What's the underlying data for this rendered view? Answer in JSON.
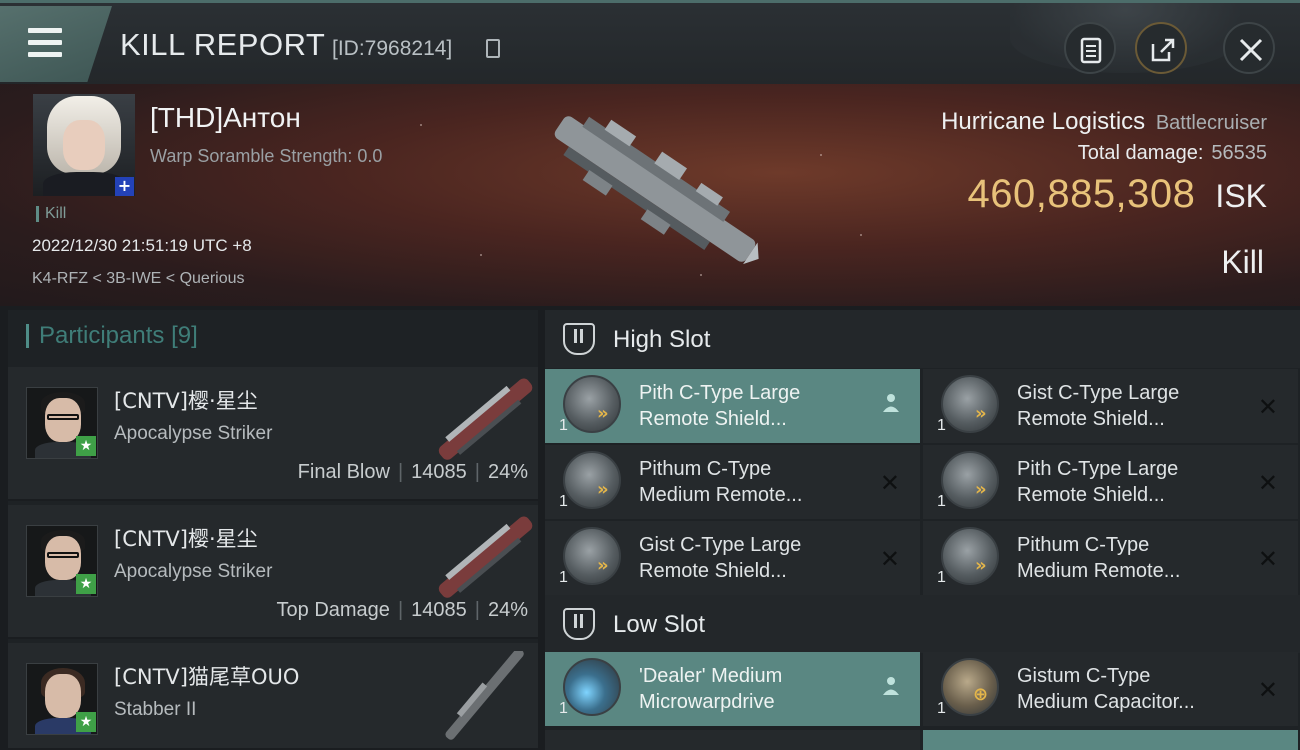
{
  "header": {
    "title": "KILL REPORT",
    "report_id": "[ID:7968214]",
    "menu_icon": "hamburger-icon",
    "actions": [
      "clipboard-icon",
      "share-icon",
      "close-icon"
    ]
  },
  "victim": {
    "name": "[THD]Антон",
    "warp_scramble": "Warp Soramble Strength: 0.0",
    "tag": "Kill",
    "datetime": "2022/12/30 21:51:19 UTC +8",
    "location": "K4-RFZ < 3B-IWE < Querious",
    "ship_name": "Hurricane Logistics",
    "ship_class": "Battlecruiser",
    "total_damage_label": "Total damage:",
    "total_damage": "56535",
    "isk_value": "460,885,308",
    "isk_unit": "ISK",
    "result": "Kill"
  },
  "participants": {
    "label": "Participants",
    "count": "[9]",
    "items": [
      {
        "name": "[CNTV]樱·星尘",
        "ship": "Apocalypse Striker",
        "role": "Final Blow",
        "damage": "14085",
        "percent": "24%"
      },
      {
        "name": "[CNTV]樱·星尘",
        "ship": "Apocalypse Striker",
        "role": "Top Damage",
        "damage": "14085",
        "percent": "24%"
      },
      {
        "name": "[CNTV]猫尾草OUO",
        "ship": "Stabber II",
        "role": "",
        "damage": "",
        "percent": ""
      }
    ]
  },
  "slots": {
    "high": {
      "label": "High Slot",
      "items": [
        {
          "qty": "1",
          "line1": "Pith C-Type Large",
          "line2": "Remote Shield...",
          "status": "person-icon",
          "selected": true
        },
        {
          "qty": "1",
          "line1": "Gist C-Type Large",
          "line2": "Remote Shield...",
          "status": "x-icon"
        },
        {
          "qty": "1",
          "line1": "Pithum C-Type",
          "line2": "Medium Remote...",
          "status": "x-icon"
        },
        {
          "qty": "1",
          "line1": "Pith C-Type Large",
          "line2": "Remote Shield...",
          "status": "x-icon"
        },
        {
          "qty": "1",
          "line1": "Gist C-Type Large",
          "line2": "Remote Shield...",
          "status": "x-icon"
        },
        {
          "qty": "1",
          "line1": "Pithum C-Type",
          "line2": "Medium Remote...",
          "status": "x-icon"
        }
      ]
    },
    "low": {
      "label": "Low Slot",
      "items": [
        {
          "qty": "1",
          "line1": "'Dealer' Medium",
          "line2": "Microwarpdrive",
          "status": "person-icon",
          "selected": true
        },
        {
          "qty": "1",
          "line1": "Gistum C-Type",
          "line2": "Medium Capacitor...",
          "status": "x-icon"
        }
      ]
    }
  },
  "colors": {
    "accent": "#5a8782",
    "isk": "#e8c27a",
    "participants_label": "#3f7d78",
    "badge_green": "#3fa047",
    "badge_blue": "#2342b8"
  }
}
